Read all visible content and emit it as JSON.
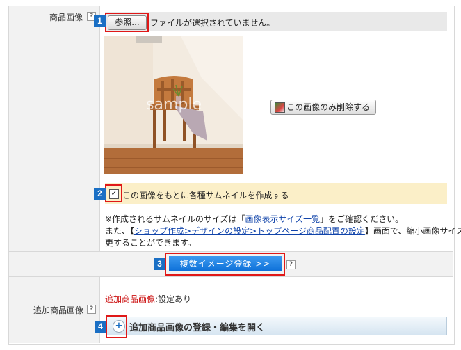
{
  "rows": {
    "product_image_label": "商品画像",
    "additional_image_label": "追加商品画像",
    "help_glyph": "?"
  },
  "file_input": {
    "browse_label": "参照...",
    "status_text": "ファイルが選択されていません。"
  },
  "preview": {
    "watermark": "sample",
    "delete_button_label": "この画像のみ削除する"
  },
  "thumbnail": {
    "checked": true,
    "check_glyph": "✓",
    "label": "この画像をもとに各種サムネイルを作成する"
  },
  "notes": {
    "line1_prefix": "※作成されるサムネイルのサイズは「",
    "line1_link": "画像表示サイズ一覧",
    "line1_suffix": "」をご確認ください。",
    "line2_prefix": "また、【",
    "line2_link": "ショップ作成>デザインの設定>トップページ商品配置の設定",
    "line2_suffix": "】画面で、縮小画像サイズを変",
    "line3": "更することができます。"
  },
  "multi_image": {
    "button_label": "複数イメージ登録 >>"
  },
  "additional": {
    "status_key": "追加商品画像",
    "status_value": ":設定あり",
    "expand_label": "追加商品画像の登録・編集を開く",
    "expand_glyph": "+"
  },
  "badges": [
    "1",
    "2",
    "3",
    "4"
  ],
  "colors": {
    "accent_blue": "#1a6fc4",
    "highlight_red": "#e01818",
    "thumbnail_bar": "#fbefc8"
  }
}
